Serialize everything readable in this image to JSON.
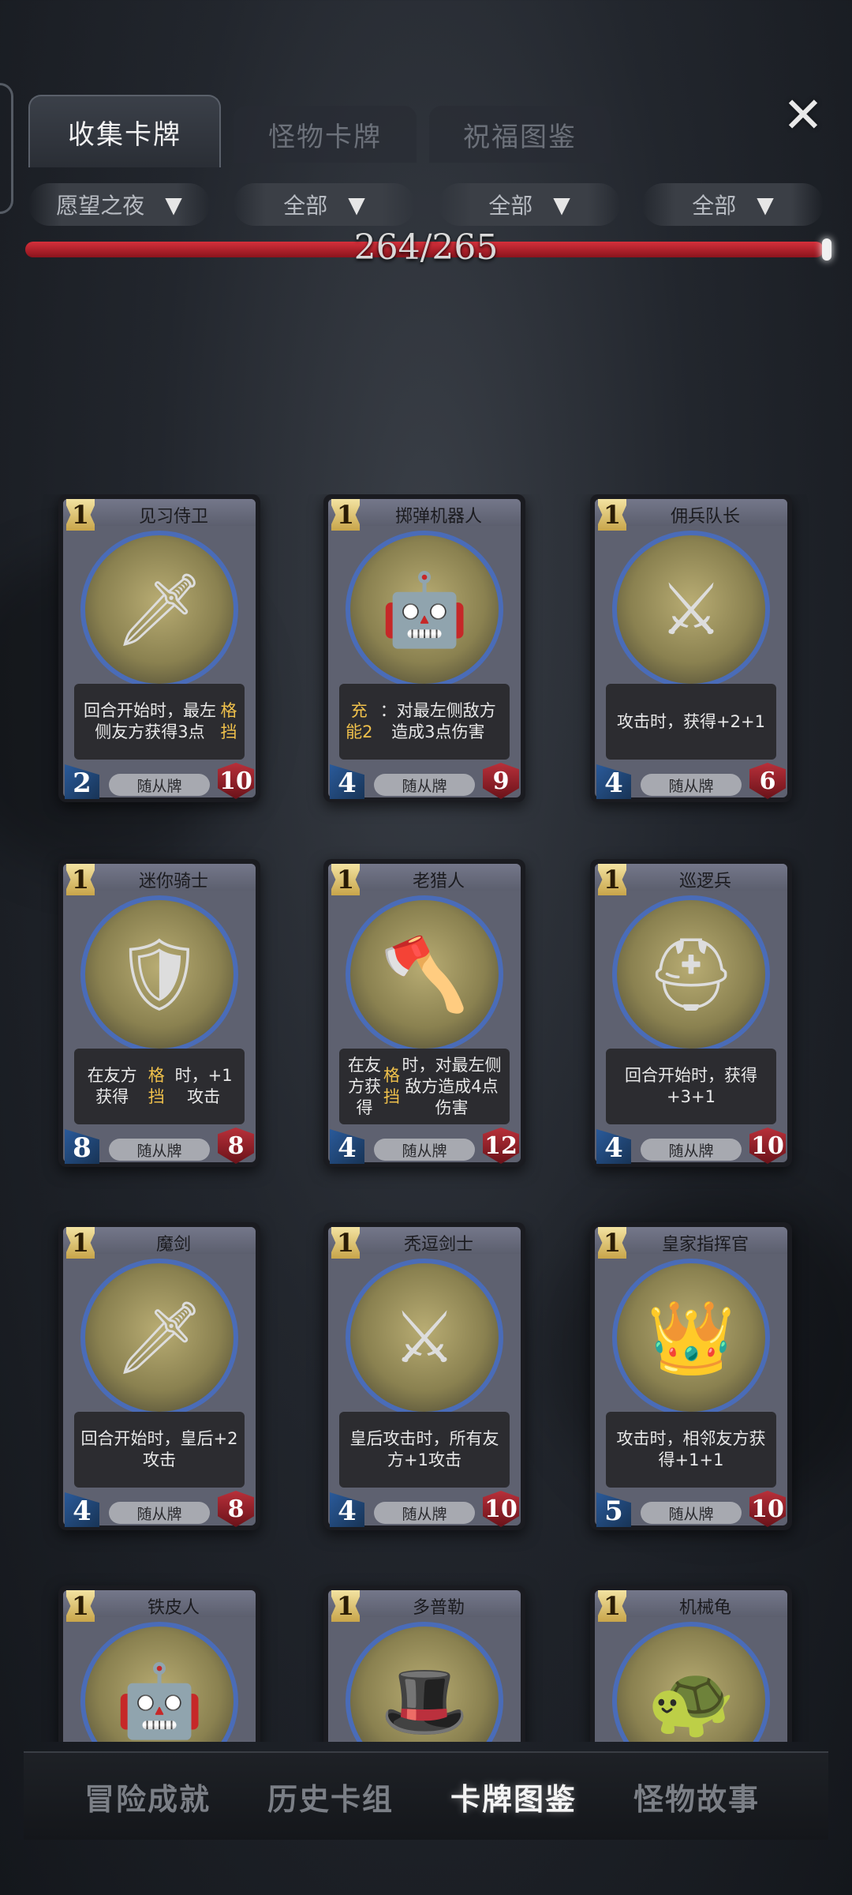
{
  "tabs": [
    {
      "label": "收集卡牌",
      "active": true
    },
    {
      "label": "怪物卡牌",
      "active": false
    },
    {
      "label": "祝福图鉴",
      "active": false
    }
  ],
  "close_icon": "close-x-icon",
  "filters": [
    "愿望之夜",
    "全部",
    "全部",
    "全部"
  ],
  "progress": {
    "text": "264/265",
    "collected": 264,
    "total": 265,
    "color": "#c8242f"
  },
  "cards": [
    {
      "cost": "1",
      "name": "见习侍卫",
      "desc_html": "回合开始时，最左侧友方获得3点<span class=\"kw\">格挡</span>",
      "desc": "回合开始时，最左侧友方获得3点格挡",
      "atk": "2",
      "hp": "10",
      "type": "随从牌",
      "portrait": "girl-knight"
    },
    {
      "cost": "1",
      "name": "掷弹机器人",
      "desc_html": "<span class=\"kw\">充能2</span>：对最左侧敌方造成3点伤害",
      "desc": "充能2：对最左侧敌方造成3点伤害",
      "atk": "4",
      "hp": "9",
      "type": "随从牌",
      "portrait": "bomb-robot"
    },
    {
      "cost": "1",
      "name": "佣兵队长",
      "desc_html": "攻击时，获得+2+1",
      "desc": "攻击时，获得+2+1",
      "atk": "4",
      "hp": "6",
      "type": "随从牌",
      "portrait": "mercenary-captain"
    },
    {
      "cost": "1",
      "name": "迷你骑士",
      "desc_html": "在友方获得<span class=\"kw\">格挡</span>时，+1攻击",
      "desc": "在友方获得格挡时，+1攻击",
      "atk": "8",
      "hp": "8",
      "type": "随从牌",
      "portrait": "mini-knight"
    },
    {
      "cost": "1",
      "name": "老猎人",
      "desc_html": "在友方获得<span class=\"kw\">格挡</span>时，对最左侧敌方造成4点伤害",
      "desc": "在友方获得格挡时，对最左侧敌方造成4点伤害",
      "atk": "4",
      "hp": "12",
      "type": "随从牌",
      "portrait": "old-hunter"
    },
    {
      "cost": "1",
      "name": "巡逻兵",
      "desc_html": "回合开始时，获得+3+1",
      "desc": "回合开始时，获得+3+1",
      "atk": "4",
      "hp": "10",
      "type": "随从牌",
      "portrait": "patrol-soldier"
    },
    {
      "cost": "1",
      "name": "魔剑",
      "desc_html": "回合开始时，皇后+2攻击",
      "desc": "回合开始时，皇后+2攻击",
      "atk": "4",
      "hp": "8",
      "type": "随从牌",
      "portrait": "demon-sword"
    },
    {
      "cost": "1",
      "name": "秃逗剑士",
      "desc_html": "皇后攻击时，所有友方+1攻击",
      "desc": "皇后攻击时，所有友方+1攻击",
      "atk": "4",
      "hp": "10",
      "type": "随从牌",
      "portrait": "bald-swordsman"
    },
    {
      "cost": "1",
      "name": "皇家指挥官",
      "desc_html": "攻击时，相邻友方获得+1+1",
      "desc": "攻击时，相邻友方获得+1+1",
      "atk": "5",
      "hp": "10",
      "type": "随从牌",
      "portrait": "royal-commander"
    },
    {
      "cost": "1",
      "name": "铁皮人",
      "desc_html": "",
      "desc": "",
      "atk": "",
      "hp": "",
      "type": "",
      "portrait": "tin-man"
    },
    {
      "cost": "1",
      "name": "多普勒",
      "desc_html": "",
      "desc": "",
      "atk": "",
      "hp": "",
      "type": "",
      "portrait": "doppler"
    },
    {
      "cost": "1",
      "name": "机械龟",
      "desc_html": "",
      "desc": "",
      "atk": "",
      "hp": "",
      "type": "",
      "portrait": "mech-turtle"
    }
  ],
  "bottom_nav": [
    {
      "label": "冒险成就",
      "active": false
    },
    {
      "label": "历史卡组",
      "active": false
    },
    {
      "label": "卡牌图鉴",
      "active": true
    },
    {
      "label": "怪物故事",
      "active": false
    }
  ]
}
